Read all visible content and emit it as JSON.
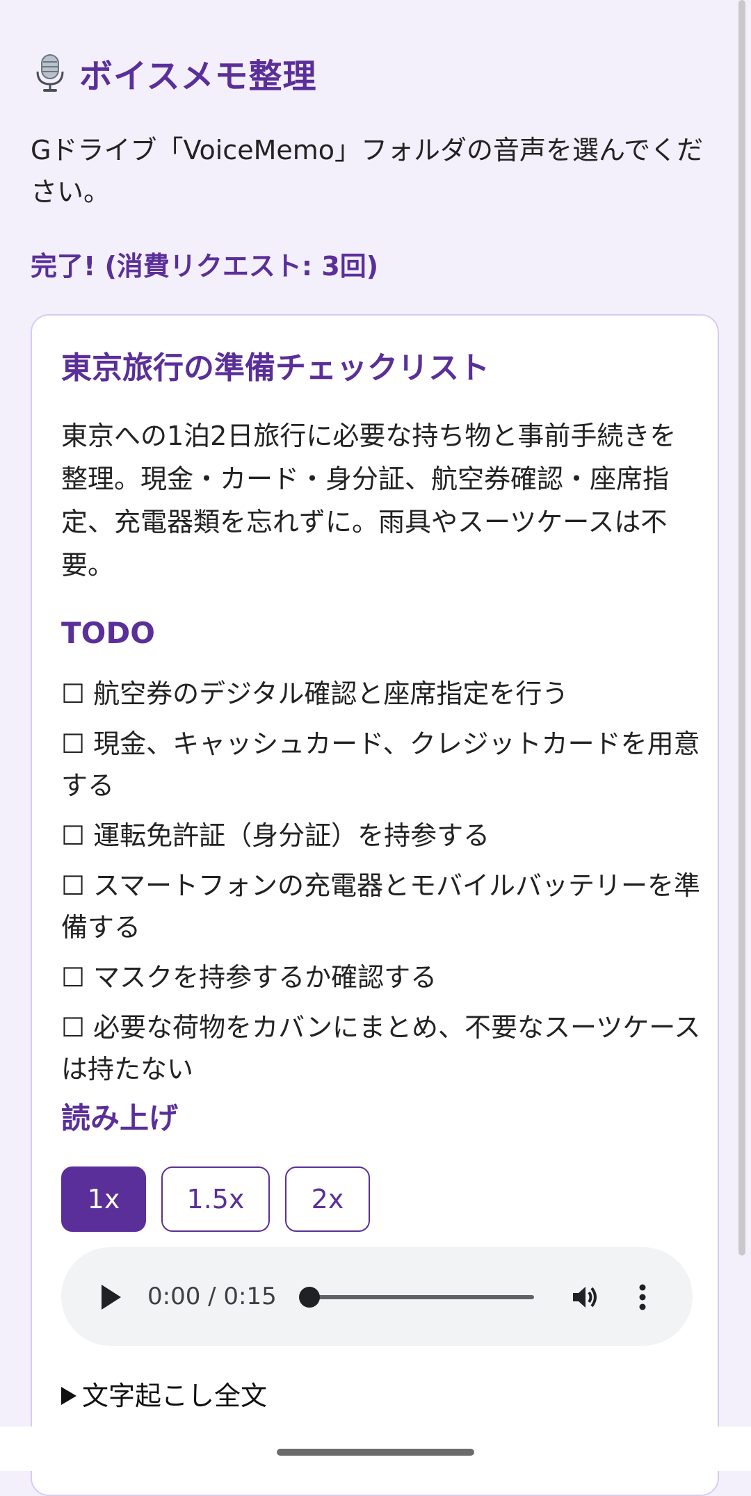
{
  "header": {
    "app_icon": "microphone-icon",
    "title": "ボイスメモ整理"
  },
  "intro": "Gドライブ「VoiceMemo」フォルダの音声を選んでください。",
  "status": "完了! (消費リクエスト: 3回)",
  "result": {
    "title": "東京旅行の準備チェックリスト",
    "summary": "東京への1泊2日旅行に必要な持ち物と事前手続きを整理。現金・カード・身分証、航空券確認・座席指定、充電器類を忘れずに。雨具やスーツケースは不要。",
    "todo_heading": "TODO",
    "todos": [
      "☐ 航空券のデジタル確認と座席指定を行う",
      "☐ 現金、キャッシュカード、クレジットカードを用意する",
      "☐ 運転免許証（身分証）を持参する",
      "☐ スマートフォンの充電器とモバイルバッテリーを準備する",
      "☐ マスクを持参するか確認する",
      "☐ 必要な荷物をカバンにまとめ、不要なスーツケースは持たない"
    ],
    "readout_heading": "読み上げ",
    "speeds": [
      "1x",
      "1.5x",
      "2x"
    ],
    "selected_speed": "1x",
    "player": {
      "time": "0:00 / 0:15",
      "progress": 0
    },
    "transcript_label": "文字起こし全文"
  },
  "colors": {
    "accent": "#5a2f99",
    "background": "#f3effb",
    "card": "#ffffff"
  }
}
